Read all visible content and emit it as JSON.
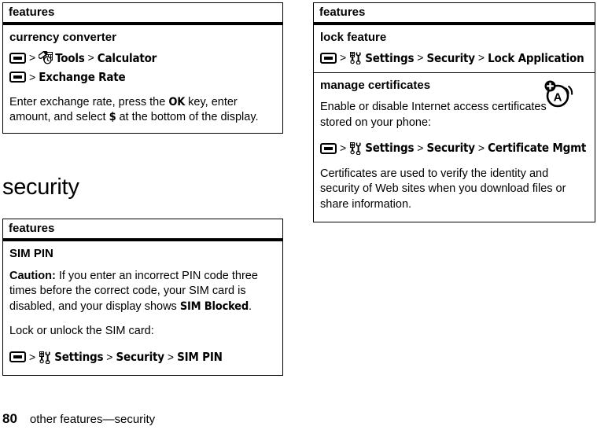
{
  "page": {
    "number": "80",
    "breadcrumb": "other features—security"
  },
  "section_heading": "security",
  "icons": {
    "menu_key": "menu-key-icon",
    "tools": "tools-icon",
    "settings": "settings-icon",
    "certificate": "certificate-badge-icon"
  },
  "separators": {
    "gt": ">"
  },
  "left_table": {
    "header": "features",
    "rows": [
      {
        "title": "currency converter",
        "paths": [
          {
            "key": "menu-key-icon",
            "steps": [
              "Tools",
              "Calculator"
            ],
            "icon": "tools-icon"
          },
          {
            "key": "menu-key-icon",
            "steps": [
              "Exchange Rate"
            ],
            "icon": null
          }
        ],
        "paragraphs": [
          {
            "parts": [
              {
                "text": "Enter exchange rate, press the ",
                "style": "normal"
              },
              {
                "text": "OK",
                "style": "cond"
              },
              {
                "text": " key, enter amount, and select ",
                "style": "normal"
              },
              {
                "text": "$",
                "style": "cond"
              },
              {
                "text": " at the bottom of the display.",
                "style": "normal"
              }
            ]
          }
        ]
      }
    ]
  },
  "second_table": {
    "header": "features",
    "rows": [
      {
        "title": "SIM PIN",
        "paragraphs": [
          {
            "parts": [
              {
                "text": "Caution:",
                "style": "bold"
              },
              {
                "text": " If you enter an incorrect PIN code three times before the correct code, your SIM card is disabled, and your display shows ",
                "style": "normal"
              },
              {
                "text": "SIM Blocked",
                "style": "cond"
              },
              {
                "text": ".",
                "style": "normal"
              }
            ]
          },
          {
            "parts": [
              {
                "text": "Lock or unlock the SIM card:",
                "style": "normal"
              }
            ]
          }
        ],
        "paths": [
          {
            "key": "menu-key-icon",
            "steps": [
              "Settings",
              "Security",
              "SIM PIN"
            ],
            "icon": "settings-icon"
          }
        ]
      }
    ]
  },
  "right_table": {
    "header": "features",
    "rows": [
      {
        "title": "lock feature",
        "paths": [
          {
            "key": "menu-key-icon",
            "steps": [
              "Settings",
              "Security",
              "Lock Application"
            ],
            "icon": "settings-icon"
          }
        ],
        "paragraphs": []
      },
      {
        "title": "manage certificates",
        "badge": "certificate-badge-icon",
        "paragraphs_before": [
          {
            "parts": [
              {
                "text": "Enable or disable Internet access certificates stored on your phone:",
                "style": "normal"
              }
            ]
          }
        ],
        "paths": [
          {
            "key": "menu-key-icon",
            "steps": [
              "Settings",
              "Security",
              "Certificate Mgmt"
            ],
            "icon": "settings-icon"
          }
        ],
        "paragraphs_after": [
          {
            "parts": [
              {
                "text": "Certificates are used to verify the identity and security of Web sites when you download files or share information.",
                "style": "normal"
              }
            ]
          }
        ]
      }
    ]
  },
  "colors": {
    "ink": "#000000",
    "page": "#ffffff"
  }
}
